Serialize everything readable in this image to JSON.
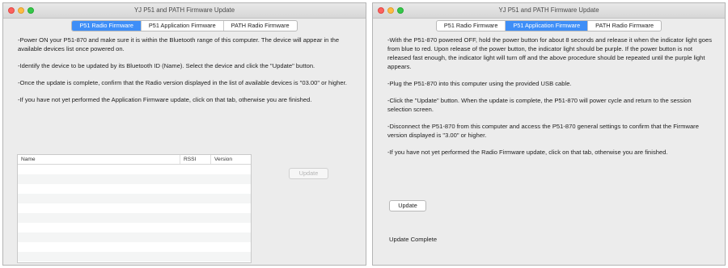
{
  "windows": [
    {
      "title": "YJ P51 and PATH Firmware Update",
      "tabs": [
        {
          "label": "P51 Radio Firmware",
          "active": true
        },
        {
          "label": "P51 Application Firmware",
          "active": false
        },
        {
          "label": "PATH Radio Firmware",
          "active": false
        }
      ],
      "paragraphs": [
        "-Power ON your P51-870 and make sure it is within the Bluetooth range of this computer. The device will appear in the available devices list once powered on.",
        "-Identify the device to be updated by its Bluetooth ID (Name). Select the device and click the \"Update\" button.",
        "-Once the update is complete, confirm that the Radio version displayed in the list of available devices is \"03.00\" or higher.",
        "-If you have not yet performed the Application Firmware update, click on that tab, otherwise you are finished."
      ],
      "table": {
        "columns": [
          "Name",
          "RSSI",
          "Version"
        ],
        "rows": []
      },
      "update_button": {
        "label": "Update",
        "enabled": false
      }
    },
    {
      "title": "YJ P51 and PATH Firmware Update",
      "tabs": [
        {
          "label": "P51 Radio Firmware",
          "active": false
        },
        {
          "label": "P51 Application Firmware",
          "active": true
        },
        {
          "label": "PATH Radio Firmware",
          "active": false
        }
      ],
      "paragraphs": [
        "-With the P51-870 powered OFF, hold the power button for about 8 seconds and release it when the indicator light goes from blue to red. Upon release of the power button, the indicator light should be purple. If the power button is not released fast enough, the indicator light will turn off and the above procedure should be repeated until the purple light appears.",
        "-Plug the P51-870 into this computer using the provided USB cable.",
        "-Click the \"Update\" button. When the update is complete, the P51-870 will power cycle and return to the session selection screen.",
        "-Disconnect the P51-870 from this computer and access the P51-870 general settings to confirm that the Firmware version displayed is \"3.00\" or higher.",
        "-If you have not yet performed the Radio Firmware update, click on that tab, otherwise you are finished."
      ],
      "update_button": {
        "label": "Update",
        "enabled": true
      },
      "status": "Update Complete"
    }
  ],
  "colors": {
    "active_tab": "#3e8ef7",
    "close": "#fc615d",
    "minimize": "#fdbc40",
    "maximize": "#34c84a"
  }
}
